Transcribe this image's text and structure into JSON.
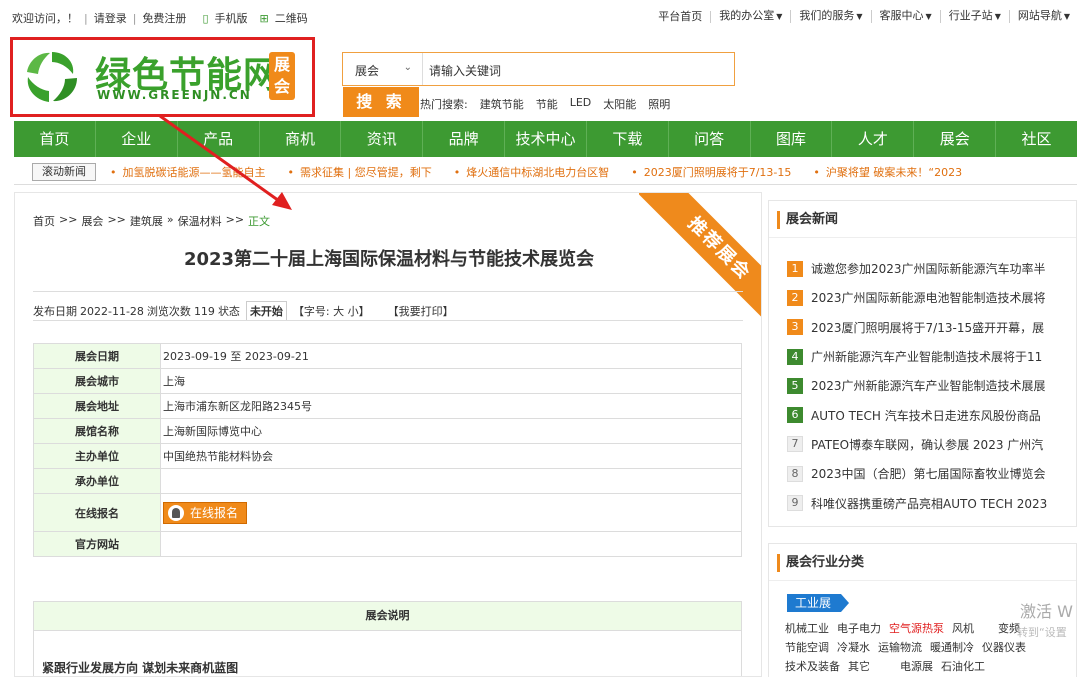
{
  "topbar": {
    "welcome": "欢迎访问，！",
    "login": "请登录",
    "register": "免费注册",
    "mobile": "手机版",
    "qrcode": "二维码",
    "right": [
      "平台首页",
      "我的办公室",
      "我们的服务",
      "客服中心",
      "行业子站",
      "网站导航"
    ]
  },
  "logo": {
    "title": "绿色节能网",
    "url": "WWW.GREENJN.CN",
    "tag": "展会"
  },
  "search": {
    "scope": "展会",
    "placeholder": "请输入关键词",
    "button": "搜 索",
    "hot_label": "热门搜索:",
    "hot": [
      "建筑节能",
      "节能",
      "LED",
      "太阳能",
      "照明"
    ]
  },
  "nav": [
    "首页",
    "企业",
    "产品",
    "商机",
    "资讯",
    "品牌",
    "技术中心",
    "下载",
    "问答",
    "图库",
    "人才",
    "展会",
    "社区"
  ],
  "scroll": {
    "label": "滚动新闻",
    "items": [
      "加氢脱碳话能源——氢能自主",
      "需求征集 | 您尽管提，剩下",
      "烽火通信中标湖北电力台区智",
      "2023厦门照明展将于7/13-15",
      "沪聚将望 破案未来！“2023"
    ]
  },
  "article": {
    "breadcrumb": [
      "首页",
      ">>",
      "展会",
      ">>",
      "建筑展",
      "»",
      "保温材料",
      ">>",
      "正文"
    ],
    "corner": "推荐展会",
    "title": "2023第二十届上海国际保温材料与节能技术展览会",
    "meta": {
      "date_label": "发布日期",
      "date": "2022-11-28",
      "views_label": "浏览次数",
      "views": "119",
      "status_label": "状态",
      "status": "未开始",
      "font": "【字号: 大 小】",
      "print": "【我要打印】"
    },
    "rows": [
      {
        "k": "展会日期",
        "v": "2023-09-19 至 2023-09-21"
      },
      {
        "k": "展会城市",
        "v": "上海"
      },
      {
        "k": "展会地址",
        "v": "上海市浦东新区龙阳路2345号"
      },
      {
        "k": "展馆名称",
        "v": "上海新国际博览中心"
      },
      {
        "k": "主办单位",
        "v": "中国绝热节能材料协会"
      },
      {
        "k": "承办单位",
        "v": ""
      },
      {
        "k": "在线报名",
        "v": ""
      },
      {
        "k": "官方网站",
        "v": ""
      }
    ],
    "register_btn": "在线报名",
    "desc_head": "展会说明",
    "desc_line": "紧跟行业发展方向 谋划未来商机蓝图"
  },
  "side_news": {
    "title": "展会新闻",
    "items": [
      {
        "n": "1",
        "t": "诚邀您参加2023广州国际新能源汽车功率半"
      },
      {
        "n": "2",
        "t": "2023广州国际新能源电池智能制造技术展将"
      },
      {
        "n": "3",
        "t": "2023厦门照明展将于7/13-15盛开开幕，展"
      },
      {
        "n": "4",
        "t": "广州新能源汽车产业智能制造技术展将于11"
      },
      {
        "n": "5",
        "t": "2023广州新能源汽车产业智能制造技术展展"
      },
      {
        "n": "6",
        "t": "AUTO TECH 汽车技术日走进东风股份商品"
      },
      {
        "n": "7",
        "t": "PATEO博泰车联网，确认参展 2023 广州汽"
      },
      {
        "n": "8",
        "t": "2023中国（合肥）第七届国际畜牧业博览会"
      },
      {
        "n": "9",
        "t": "科唯仪器携重磅产品亮相AUTO TECH 2023"
      }
    ]
  },
  "side_ind": {
    "title": "展会行业分类",
    "tag": "工业展",
    "rows": [
      [
        "机械工业",
        "电子电力",
        "空气源热泵",
        "风机",
        "变频"
      ],
      [
        "节能空调",
        "冷凝水",
        "运输物流",
        "暖通制冷",
        "仪器仪表"
      ],
      [
        "技术及装备",
        "其它",
        "电源展",
        "石油化工",
        ""
      ]
    ]
  },
  "watermark": {
    "line1": "激活 W",
    "line2": "转到“设置"
  },
  "colors": {
    "green": "#3d9a32",
    "orange": "#f08a1a",
    "red_box": "#e02020"
  }
}
